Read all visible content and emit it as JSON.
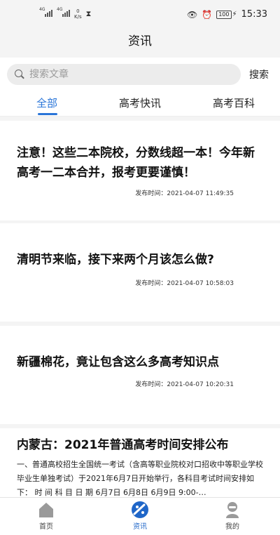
{
  "status_bar": {
    "net1": "4G",
    "net2": "4G",
    "speed_value": "0",
    "speed_unit": "K/s",
    "battery": "100",
    "time": "15:33"
  },
  "header": {
    "title": "资讯"
  },
  "search": {
    "placeholder": "搜索文章",
    "button": "搜索"
  },
  "tabs": [
    {
      "label": "全部",
      "active": true
    },
    {
      "label": "高考快讯",
      "active": false
    },
    {
      "label": "高考百科",
      "active": false
    }
  ],
  "articles": [
    {
      "title": "注意！这些二本院校，分数线超一本！今年新高考一二本合并，报考更要谨慎！",
      "time": "发布时间：2021-04-07 11:49:35"
    },
    {
      "title": "清明节来临，接下来两个月该怎么做?",
      "time": "发布时间：2021-04-07 10:58:03"
    },
    {
      "title": "新疆棉花，竟让包含这么多高考知识点",
      "time": "发布时间：2021-04-07 10:20:31"
    },
    {
      "title": "内蒙古：2021年普通高考时间安排公布",
      "summary": "一、普通高校招生全国统一考试（含高等职业院校对口招收中等职业学校毕业生单独考试）于2021年6月7日开始举行，各科目考试时间安排如下： 时 间 科 目 日 期 6月7日 6月8日 6月9日 9:00-…"
    }
  ],
  "bottom_nav": [
    {
      "label": "首页",
      "icon": "home-icon",
      "active": false
    },
    {
      "label": "资讯",
      "icon": "news-icon",
      "active": true
    },
    {
      "label": "我的",
      "icon": "profile-icon",
      "active": false
    }
  ],
  "colors": {
    "accent": "#2a75d8",
    "background": "#f4f4f4"
  }
}
